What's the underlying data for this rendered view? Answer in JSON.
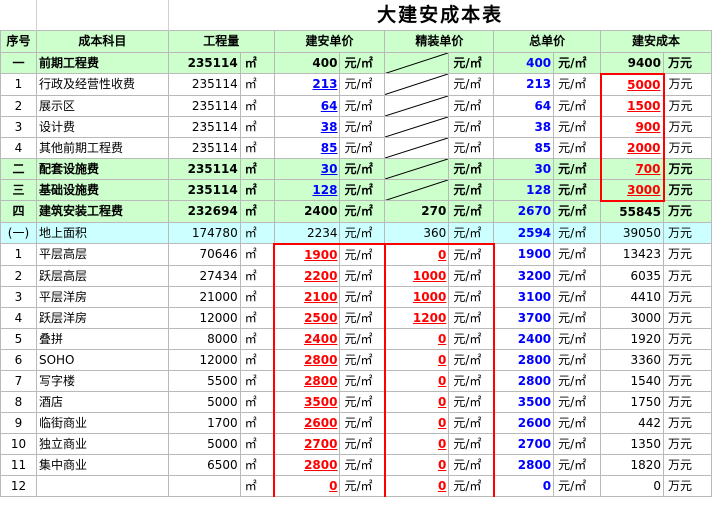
{
  "title": "大建安成本表",
  "headers": [
    "序号",
    "成本科目",
    "工程量",
    "建安单价",
    "精装单价",
    "总单价",
    "建安成本"
  ],
  "units": {
    "area": "㎡",
    "price": "元/㎡",
    "cost": "万元"
  },
  "rows": [
    {
      "no": "一",
      "name": "前期工程费",
      "qty": "235114",
      "ja": "400",
      "jz": "",
      "total": "400",
      "cost": "9400",
      "type": "sect",
      "jaStyle": "plain",
      "jzStyle": "diag",
      "costStyle": "plain"
    },
    {
      "no": "1",
      "name": "行政及经营性收费",
      "qty": "235114",
      "ja": "213",
      "jz": "",
      "total": "213",
      "cost": "5000",
      "type": "normal",
      "jaStyle": "ubl",
      "jzStyle": "diag",
      "costStyle": "red"
    },
    {
      "no": "2",
      "name": "展示区",
      "qty": "235114",
      "ja": "64",
      "jz": "",
      "total": "64",
      "cost": "1500",
      "type": "normal",
      "jaStyle": "ubl",
      "jzStyle": "diag",
      "costStyle": "red"
    },
    {
      "no": "3",
      "name": "设计费",
      "qty": "235114",
      "ja": "38",
      "jz": "",
      "total": "38",
      "cost": "900",
      "type": "normal",
      "jaStyle": "ubl",
      "jzStyle": "diag",
      "costStyle": "red"
    },
    {
      "no": "4",
      "name": "其他前期工程费",
      "qty": "235114",
      "ja": "85",
      "jz": "",
      "total": "85",
      "cost": "2000",
      "type": "normal",
      "jaStyle": "ubl",
      "jzStyle": "diag",
      "costStyle": "red"
    },
    {
      "no": "二",
      "name": "配套设施费",
      "qty": "235114",
      "ja": "30",
      "jz": "",
      "total": "30",
      "cost": "700",
      "type": "sect",
      "jaStyle": "ubl",
      "jzStyle": "diag",
      "costStyle": "red"
    },
    {
      "no": "三",
      "name": "基础设施费",
      "qty": "235114",
      "ja": "128",
      "jz": "",
      "total": "128",
      "cost": "3000",
      "type": "sect",
      "jaStyle": "ubl",
      "jzStyle": "diag",
      "costStyle": "red"
    },
    {
      "no": "四",
      "name": "建筑安装工程费",
      "qty": "232694",
      "ja": "2400",
      "jz": "270",
      "total": "2670",
      "cost": "55845",
      "type": "sect",
      "jaStyle": "plain",
      "jzStyle": "plain",
      "costStyle": "plain"
    },
    {
      "no": "(一)",
      "name": "地上面积",
      "qty": "174780",
      "ja": "2234",
      "jz": "360",
      "total": "2594",
      "cost": "39050",
      "type": "sub",
      "jaStyle": "norm",
      "jzStyle": "norm",
      "costStyle": "norm"
    },
    {
      "no": "1",
      "name": "平层高层",
      "qty": "70646",
      "ja": "1900",
      "jz": "0",
      "total": "1900",
      "cost": "13423",
      "type": "normal",
      "jaStyle": "red",
      "jzStyle": "red",
      "costStyle": "norm"
    },
    {
      "no": "2",
      "name": "跃层高层",
      "qty": "27434",
      "ja": "2200",
      "jz": "1000",
      "total": "3200",
      "cost": "6035",
      "type": "normal",
      "jaStyle": "red",
      "jzStyle": "red",
      "costStyle": "norm"
    },
    {
      "no": "3",
      "name": "平层洋房",
      "qty": "21000",
      "ja": "2100",
      "jz": "1000",
      "total": "3100",
      "cost": "4410",
      "type": "normal",
      "jaStyle": "red",
      "jzStyle": "red",
      "costStyle": "norm"
    },
    {
      "no": "4",
      "name": "跃层洋房",
      "qty": "12000",
      "ja": "2500",
      "jz": "1200",
      "total": "3700",
      "cost": "3000",
      "type": "normal",
      "jaStyle": "red",
      "jzStyle": "red",
      "costStyle": "norm"
    },
    {
      "no": "5",
      "name": "叠拼",
      "qty": "8000",
      "ja": "2400",
      "jz": "0",
      "total": "2400",
      "cost": "1920",
      "type": "normal",
      "jaStyle": "red",
      "jzStyle": "red",
      "costStyle": "norm"
    },
    {
      "no": "6",
      "name": "SOHO",
      "qty": "12000",
      "ja": "2800",
      "jz": "0",
      "total": "2800",
      "cost": "3360",
      "type": "normal",
      "jaStyle": "red",
      "jzStyle": "red",
      "costStyle": "norm"
    },
    {
      "no": "7",
      "name": "写字楼",
      "qty": "5500",
      "ja": "2800",
      "jz": "0",
      "total": "2800",
      "cost": "1540",
      "type": "normal",
      "jaStyle": "red",
      "jzStyle": "red",
      "costStyle": "norm"
    },
    {
      "no": "8",
      "name": "酒店",
      "qty": "5000",
      "ja": "3500",
      "jz": "0",
      "total": "3500",
      "cost": "1750",
      "type": "normal",
      "jaStyle": "red",
      "jzStyle": "red",
      "costStyle": "norm"
    },
    {
      "no": "9",
      "name": "临街商业",
      "qty": "1700",
      "ja": "2600",
      "jz": "0",
      "total": "2600",
      "cost": "442",
      "type": "normal",
      "jaStyle": "red",
      "jzStyle": "red",
      "costStyle": "norm"
    },
    {
      "no": "10",
      "name": "独立商业",
      "qty": "5000",
      "ja": "2700",
      "jz": "0",
      "total": "2700",
      "cost": "1350",
      "type": "normal",
      "jaStyle": "red",
      "jzStyle": "red",
      "costStyle": "norm"
    },
    {
      "no": "11",
      "name": "集中商业",
      "qty": "6500",
      "ja": "2800",
      "jz": "0",
      "total": "2800",
      "cost": "1820",
      "type": "normal",
      "jaStyle": "red",
      "jzStyle": "red",
      "costStyle": "norm"
    },
    {
      "no": "12",
      "name": "",
      "qty": "",
      "ja": "0",
      "jz": "0",
      "total": "0",
      "cost": "0",
      "type": "normal",
      "jaStyle": "red",
      "jzStyle": "red",
      "costStyle": "norm"
    }
  ]
}
